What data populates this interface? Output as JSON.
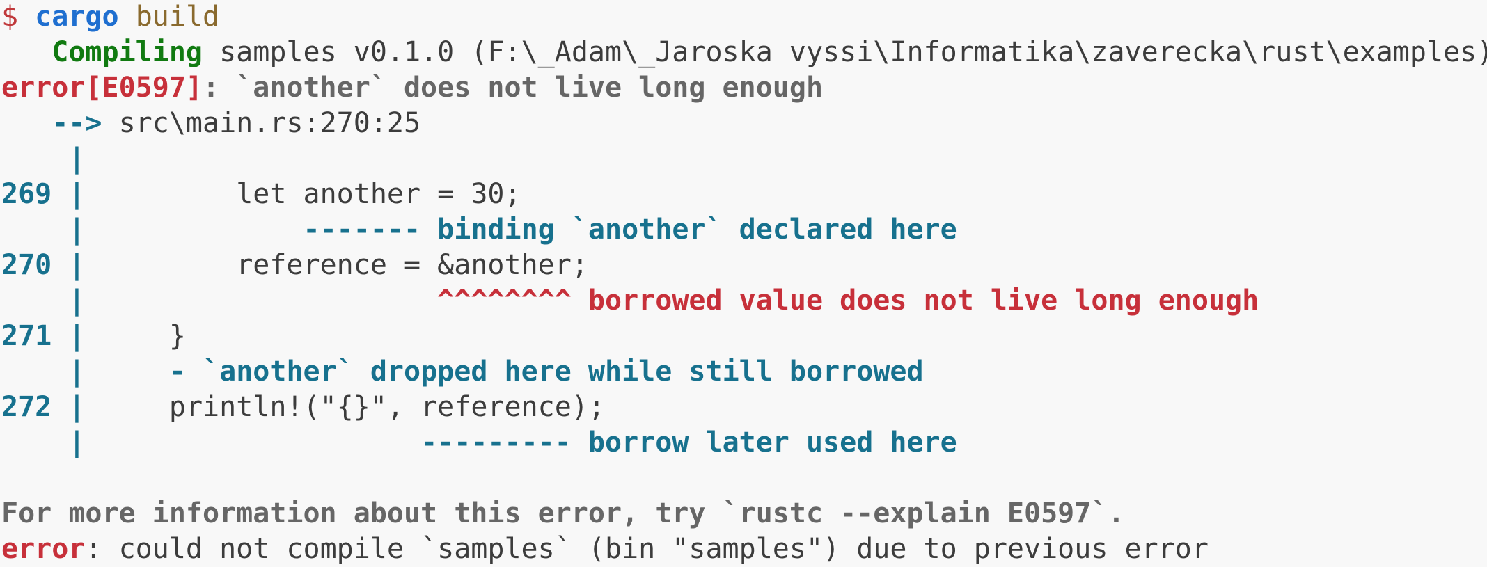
{
  "terminal": {
    "prompt_symbol": "$",
    "command": "cargo",
    "argument": "build",
    "compiling_label": "Compiling",
    "compiling_target": "samples v0.1.0 (F:\\_Adam\\_Jaroska vyssi\\Informatika\\zaverecka\\rust\\examples)",
    "error_code_label": "error[E0597]",
    "error_message": ": `another` does not live long enough",
    "location_arrow": "-->",
    "location_path": "src\\main.rs:270:25",
    "gutter_bar": "|",
    "code_lines": [
      {
        "number": "269",
        "code": "        let another = 30;"
      },
      {
        "number": "270",
        "code": "        reference = &another;"
      },
      {
        "number": "271",
        "code": "    }"
      },
      {
        "number": "272",
        "code": "    println!(\"{}\", reference);"
      }
    ],
    "annotations": {
      "declared_marker": "-------",
      "declared_text": "binding `another` declared here",
      "borrow_marker": "^^^^^^^^",
      "borrow_text": "borrowed value does not live long enough",
      "dropped_marker": "-",
      "dropped_text": "`another` dropped here while still borrowed",
      "later_marker": "---------",
      "later_text": "borrow later used here"
    },
    "help_text": "For more information about this error, try `rustc --explain E0597`.",
    "final_error_label": "error",
    "final_error_message": ": could not compile `samples` (bin \"samples\") due to previous error"
  },
  "colors": {
    "background": "#f8f8f8",
    "prompt": "#c0393b",
    "command": "#1f6fd0",
    "compiling": "#117a11",
    "error": "#c7303a",
    "info": "#17718e",
    "help": "#666666"
  }
}
